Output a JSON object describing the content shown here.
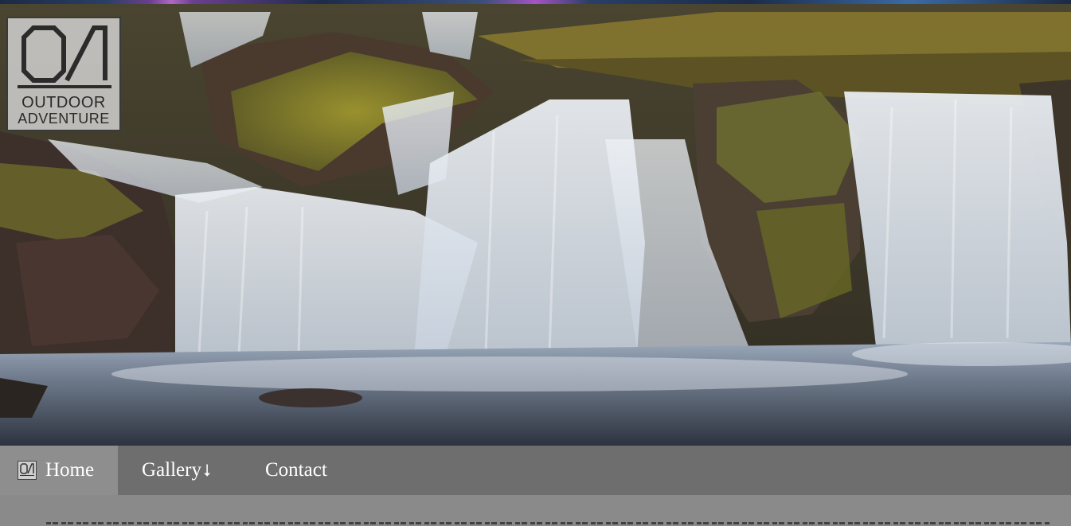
{
  "brand": {
    "logo_line1": "OUTDOOR",
    "logo_line2": "ADVENTURE",
    "accent_color": "#8e8e8e",
    "nav_color": "#6e6e6e"
  },
  "hero": {
    "image": "waterfall-photo"
  },
  "nav": {
    "items": [
      {
        "label": "Home",
        "icon": "logo-icon",
        "active": true
      },
      {
        "label": "Gallery",
        "icon": "down-arrow-icon",
        "active": false
      },
      {
        "label": "Contact",
        "active": false
      }
    ],
    "gallery_arrow": "⭣"
  }
}
